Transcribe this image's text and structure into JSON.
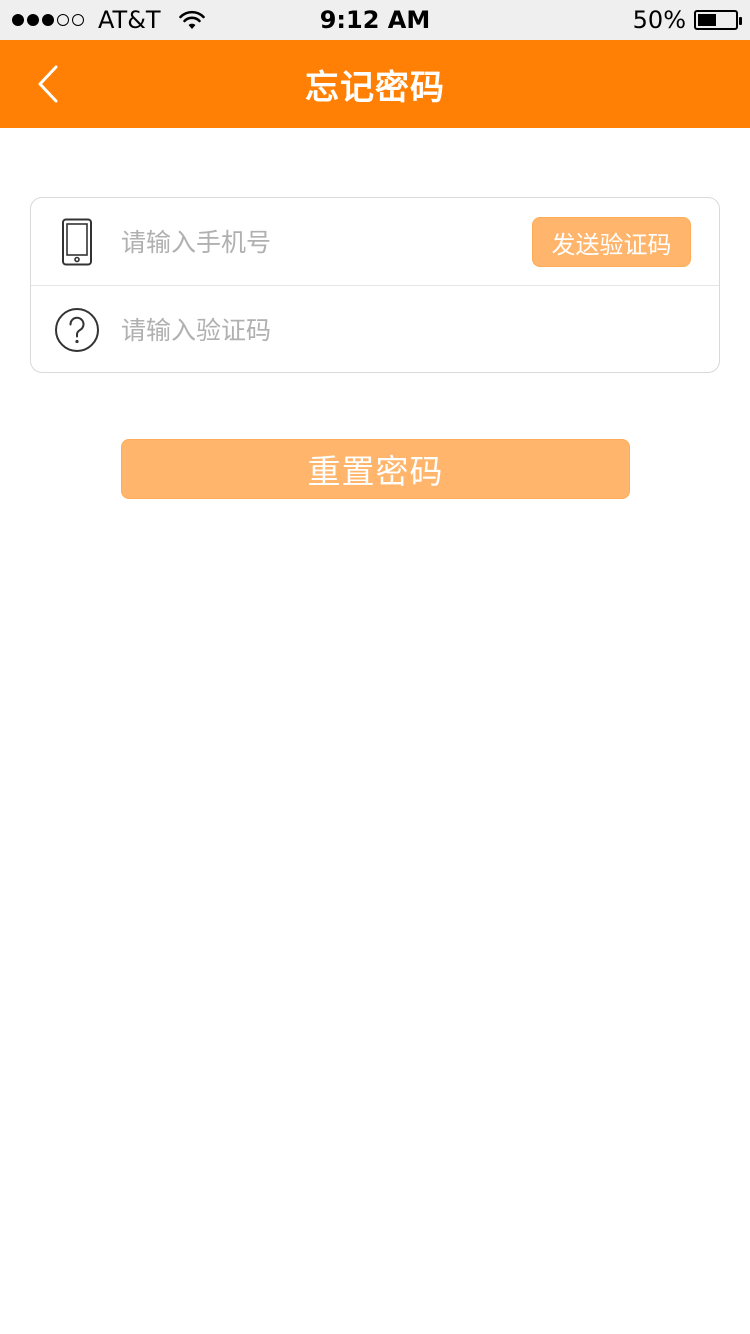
{
  "status_bar": {
    "carrier": "AT&T",
    "time": "9:12 AM",
    "battery_percent_text": "50%",
    "battery_level": 0.5,
    "signal_bars_filled": 3,
    "signal_bars_total": 5
  },
  "nav": {
    "title": "忘记密码",
    "back_icon": "chevron-left-icon"
  },
  "form": {
    "phone": {
      "icon": "phone-icon",
      "placeholder": "请输入手机号",
      "value": ""
    },
    "send_code_label": "发送验证码",
    "code": {
      "icon": "question-circle-icon",
      "placeholder": "请输入验证码",
      "value": ""
    }
  },
  "reset_button_label": "重置密码",
  "colors": {
    "nav_background": "#ff8004",
    "button_background": "#ffb56b",
    "placeholder": "#b0b0b0"
  }
}
